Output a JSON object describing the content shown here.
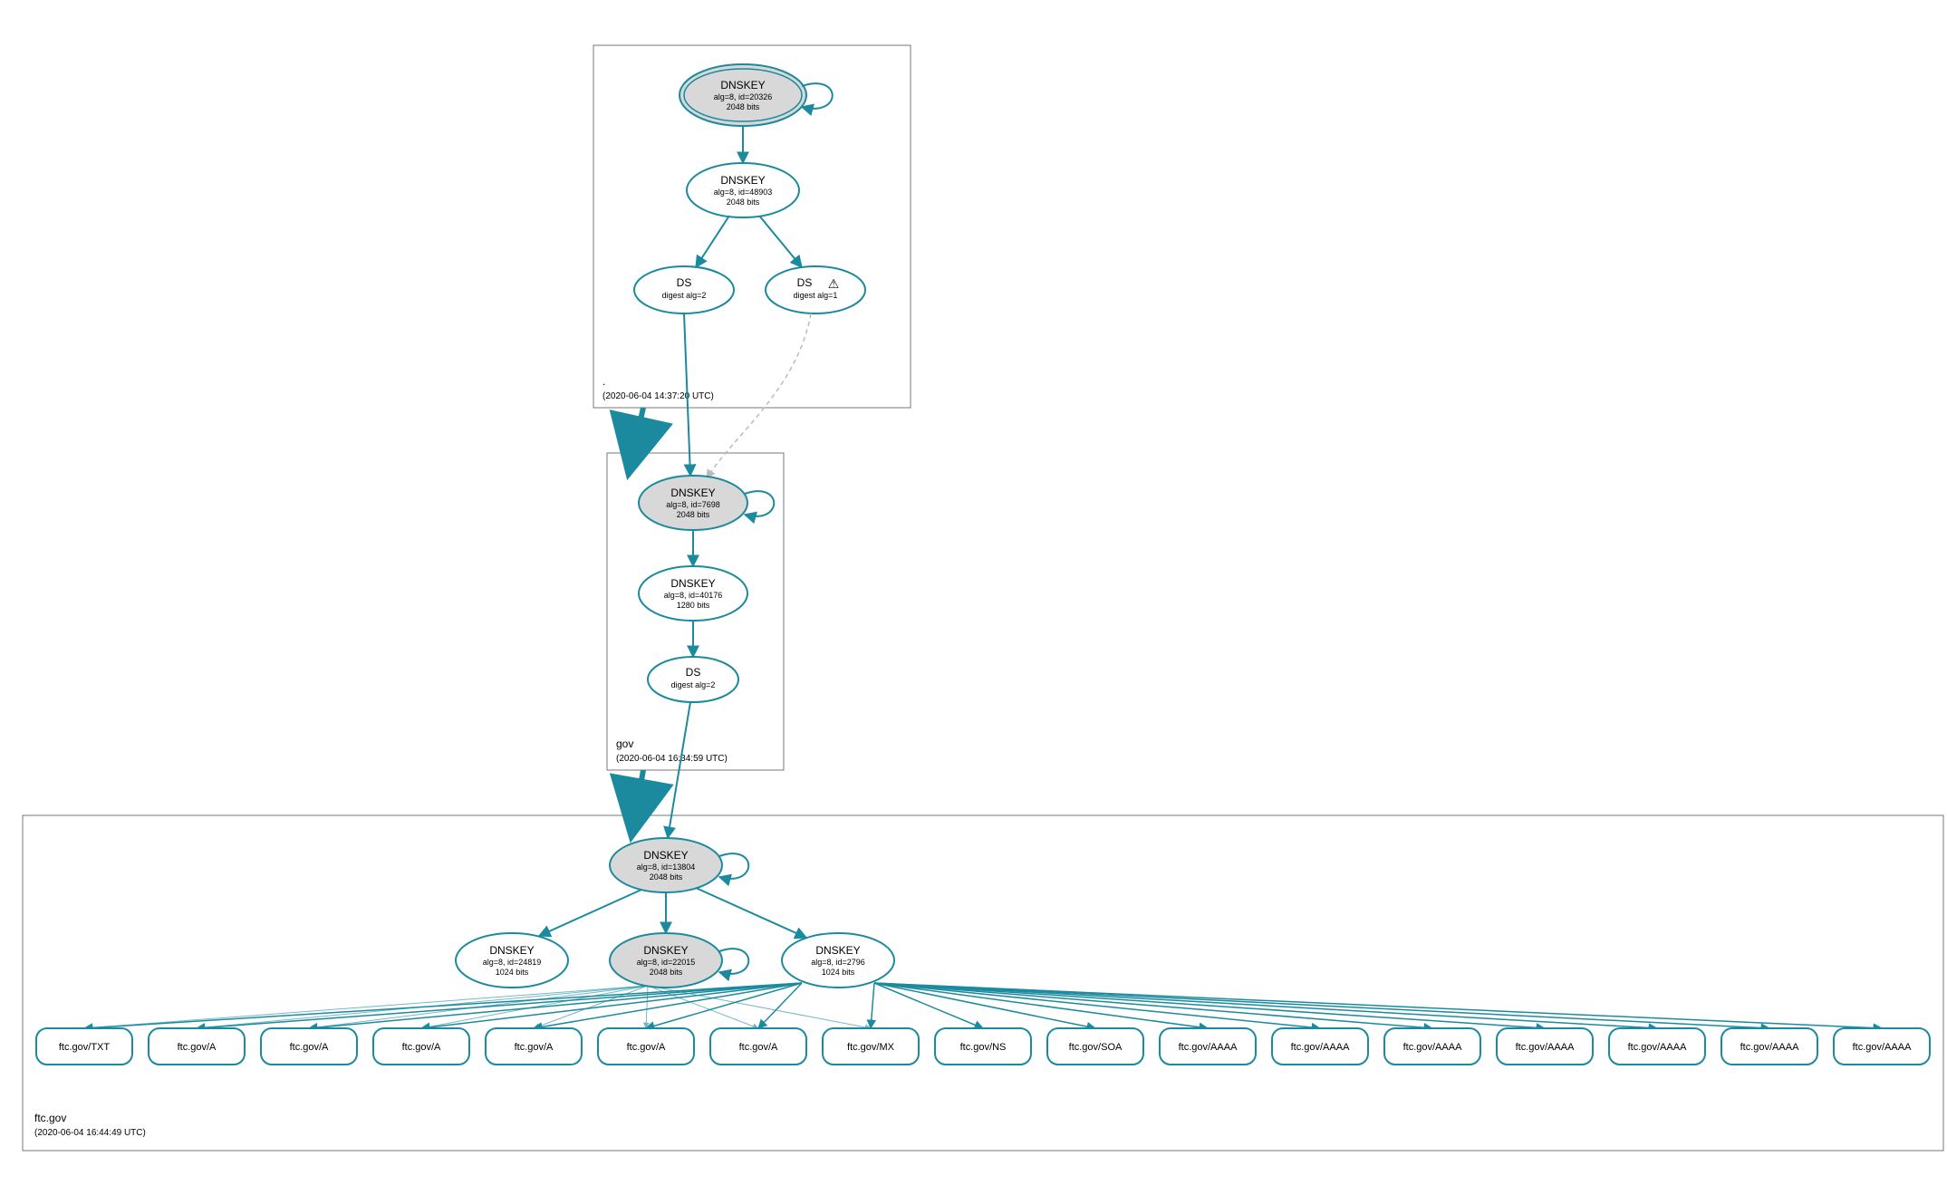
{
  "colors": {
    "teal": "#1b8a9e",
    "greyFill": "#d8d8d8",
    "boxStroke": "#777",
    "dashed": "#bbb"
  },
  "zones": {
    "root": {
      "label": ".",
      "timestamp": "(2020-06-04 14:37:20 UTC)"
    },
    "gov": {
      "label": "gov",
      "timestamp": "(2020-06-04 16:34:59 UTC)"
    },
    "ftc": {
      "label": "ftc.gov",
      "timestamp": "(2020-06-04 16:44:49 UTC)"
    }
  },
  "nodes": {
    "root_ksk": {
      "title": "DNSKEY",
      "line2": "alg=8, id=20326",
      "line3": "2048 bits"
    },
    "root_zsk": {
      "title": "DNSKEY",
      "line2": "alg=8, id=48903",
      "line3": "2048 bits"
    },
    "root_ds2": {
      "title": "DS",
      "line2": "digest alg=2"
    },
    "root_ds1": {
      "title": "DS",
      "line2": "digest alg=1"
    },
    "gov_ksk": {
      "title": "DNSKEY",
      "line2": "alg=8, id=7698",
      "line3": "2048 bits"
    },
    "gov_zsk": {
      "title": "DNSKEY",
      "line2": "alg=8, id=40176",
      "line3": "1280 bits"
    },
    "gov_ds": {
      "title": "DS",
      "line2": "digest alg=2"
    },
    "ftc_ksk": {
      "title": "DNSKEY",
      "line2": "alg=8, id=13804",
      "line3": "2048 bits"
    },
    "ftc_k2": {
      "title": "DNSKEY",
      "line2": "alg=8, id=24819",
      "line3": "1024 bits"
    },
    "ftc_k3": {
      "title": "DNSKEY",
      "line2": "alg=8, id=22015",
      "line3": "2048 bits"
    },
    "ftc_k4": {
      "title": "DNSKEY",
      "line2": "alg=8, id=2796",
      "line3": "1024 bits"
    }
  },
  "warning_icon": "⚠",
  "records": [
    "ftc.gov/TXT",
    "ftc.gov/A",
    "ftc.gov/A",
    "ftc.gov/A",
    "ftc.gov/A",
    "ftc.gov/A",
    "ftc.gov/A",
    "ftc.gov/MX",
    "ftc.gov/NS",
    "ftc.gov/SOA",
    "ftc.gov/AAAA",
    "ftc.gov/AAAA",
    "ftc.gov/AAAA",
    "ftc.gov/AAAA",
    "ftc.gov/AAAA",
    "ftc.gov/AAAA",
    "ftc.gov/AAAA"
  ]
}
